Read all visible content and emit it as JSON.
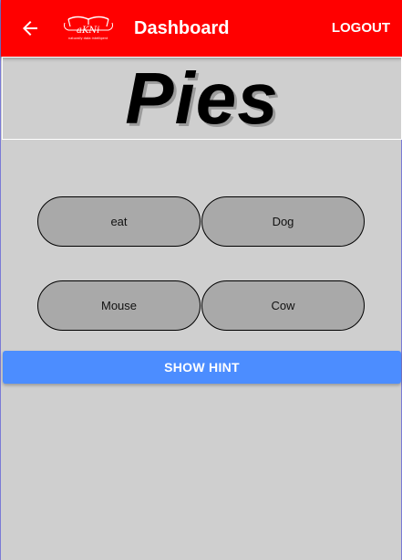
{
  "header": {
    "title": "Dashboard",
    "logout_label": "LOGOUT",
    "back_icon": "arrow-left-icon",
    "logo_icon": "logo-icon",
    "logo_tagline": "naturally data intelligent",
    "background_color": "#ff0000"
  },
  "quiz": {
    "word": "Pies",
    "options": [
      "eat",
      "Dog",
      "Mouse",
      "Cow"
    ],
    "hint_label": "SHOW HINT",
    "hint_color": "#4c8dff"
  }
}
